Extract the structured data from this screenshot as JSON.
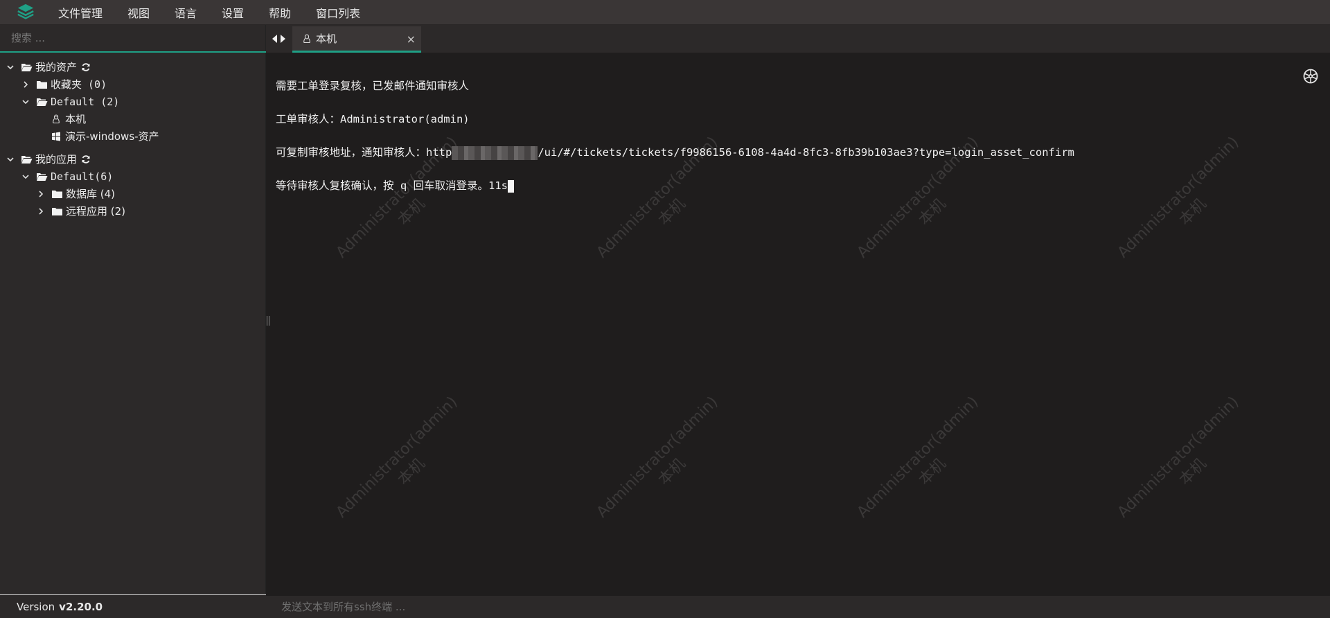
{
  "menubar": {
    "items": [
      "文件管理",
      "视图",
      "语言",
      "设置",
      "帮助",
      "窗口列表"
    ]
  },
  "sidebar": {
    "search_placeholder": "搜索 ...",
    "assets": {
      "label": "我的资产",
      "favorites": "收藏夹 (0)",
      "default": "Default (2)",
      "items": [
        "本机",
        "演示-windows-资产"
      ]
    },
    "apps": {
      "label": "我的应用",
      "default": "Default(6)",
      "items": [
        "数据库 (4)",
        "远程应用 (2)"
      ]
    }
  },
  "version": {
    "label": "Version",
    "value": "v2.20.0"
  },
  "tabs": [
    {
      "label": "本机",
      "close": "×"
    }
  ],
  "terminal": {
    "line1": "需要工单登录复核，已发邮件通知审核人",
    "line2": "工单审核人：Administrator(admin)",
    "line3_prefix": "可复制审核地址，通知审核人：http",
    "line3_suffix": "/ui/#/tickets/tickets/f9986156-6108-4a4d-8fc3-8fb39b103ae3?type=login_asset_confirm",
    "line4": "等待审核人复核确认，按 q 回车取消登录。11s",
    "watermark_user": "Administrator(admin)",
    "watermark_host": "本机"
  },
  "bottombar": {
    "placeholder": "发送文本到所有ssh终端 ..."
  },
  "colors": {
    "accent": "#1fa086",
    "background": "#1f1d1d",
    "panel": "#2c2929"
  },
  "icons": {
    "logo": "jumpserver-logo-icon",
    "folder": "folder-icon",
    "refresh": "refresh-icon",
    "linux": "linux-icon",
    "windows": "windows-icon",
    "gear": "settings-icon"
  }
}
